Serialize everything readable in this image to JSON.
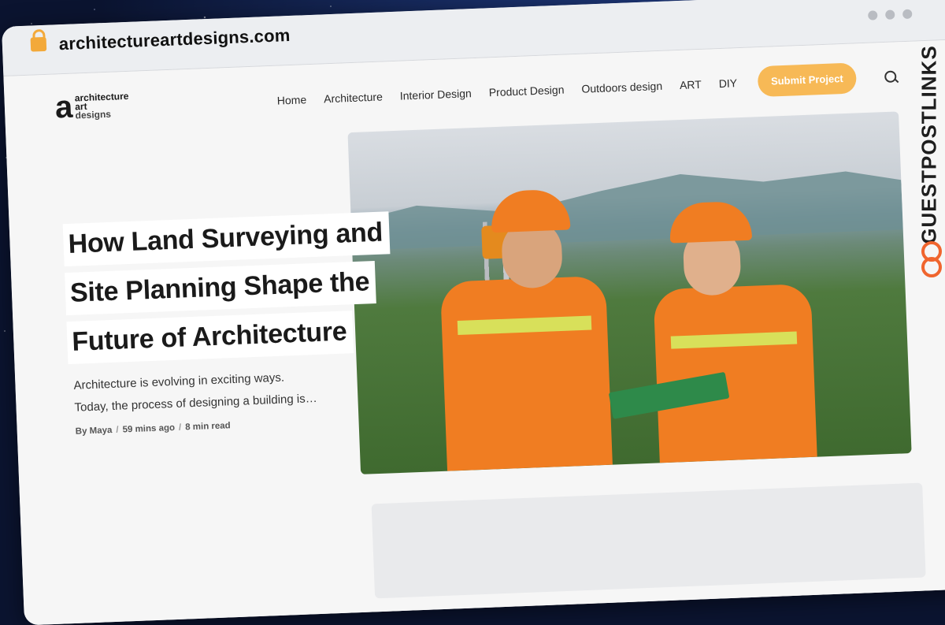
{
  "browser": {
    "url": "architectureartdesigns.com"
  },
  "logo": {
    "letter": "a",
    "line1": "architecture",
    "line2": "art",
    "line3": "designs"
  },
  "nav": {
    "items": [
      "Home",
      "Architecture",
      "Interior Design",
      "Product Design",
      "Outdoors design",
      "ART",
      "DIY"
    ],
    "submit_label": "Submit Project"
  },
  "article": {
    "title_lines": [
      "How Land Surveying and",
      "Site Planning Shape the",
      "Future of Architecture"
    ],
    "excerpt_lines": [
      "Architecture is evolving in exciting ways.",
      "Today, the process of designing a building is…"
    ],
    "author": "By Maya",
    "time": "59 mins ago",
    "read": "8 min read"
  },
  "watermark": {
    "text": "GUESTPOSTLINKS"
  }
}
